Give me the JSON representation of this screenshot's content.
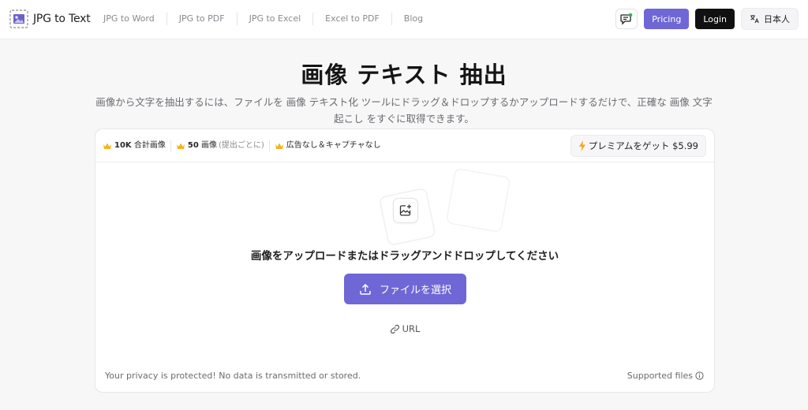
{
  "brand": {
    "name": "JPG to Text",
    "accent": "#7067d6"
  },
  "nav": {
    "items": [
      {
        "label": "JPG to Word"
      },
      {
        "label": "JPG to PDF"
      },
      {
        "label": "JPG to Excel"
      },
      {
        "label": "Excel to PDF"
      },
      {
        "label": "Blog"
      }
    ]
  },
  "header": {
    "pricing_label": "Pricing",
    "login_label": "Login",
    "language_label": "日本人"
  },
  "hero": {
    "title": "画像 テキスト 抽出",
    "description": "画像から文字を抽出するには、ファイルを 画像 テキスト化 ツールにドラッグ＆ドロップするかアップロードするだけで、正確な 画像 文字起こし をすぐに取得できます。"
  },
  "card": {
    "badges": [
      {
        "strong": "10K",
        "text": "合計画像",
        "muted": ""
      },
      {
        "strong": "50",
        "text": "画像",
        "muted": "(提出ごとに)"
      },
      {
        "strong": "",
        "text": "広告なし＆キャプチャなし",
        "muted": ""
      }
    ],
    "premium_label": "プレミアムをゲット $5.99",
    "upload_prompt": "画像をアップロードまたはドラッグアンドドロップしてください",
    "choose_label": "ファイルを選択",
    "url_label": "URL",
    "privacy_text": "Your privacy is protected! No data is transmitted or stored.",
    "supported_label": "Supported files"
  },
  "icons": {
    "logo": "image-text-logo-icon",
    "feedback": "chat-feedback-icon",
    "language": "translate-icon",
    "crown": "crown-icon",
    "bolt": "lightning-icon",
    "upload_box": "image-add-icon",
    "upload": "upload-arrow-icon",
    "link": "link-icon",
    "info": "info-circle-icon"
  }
}
